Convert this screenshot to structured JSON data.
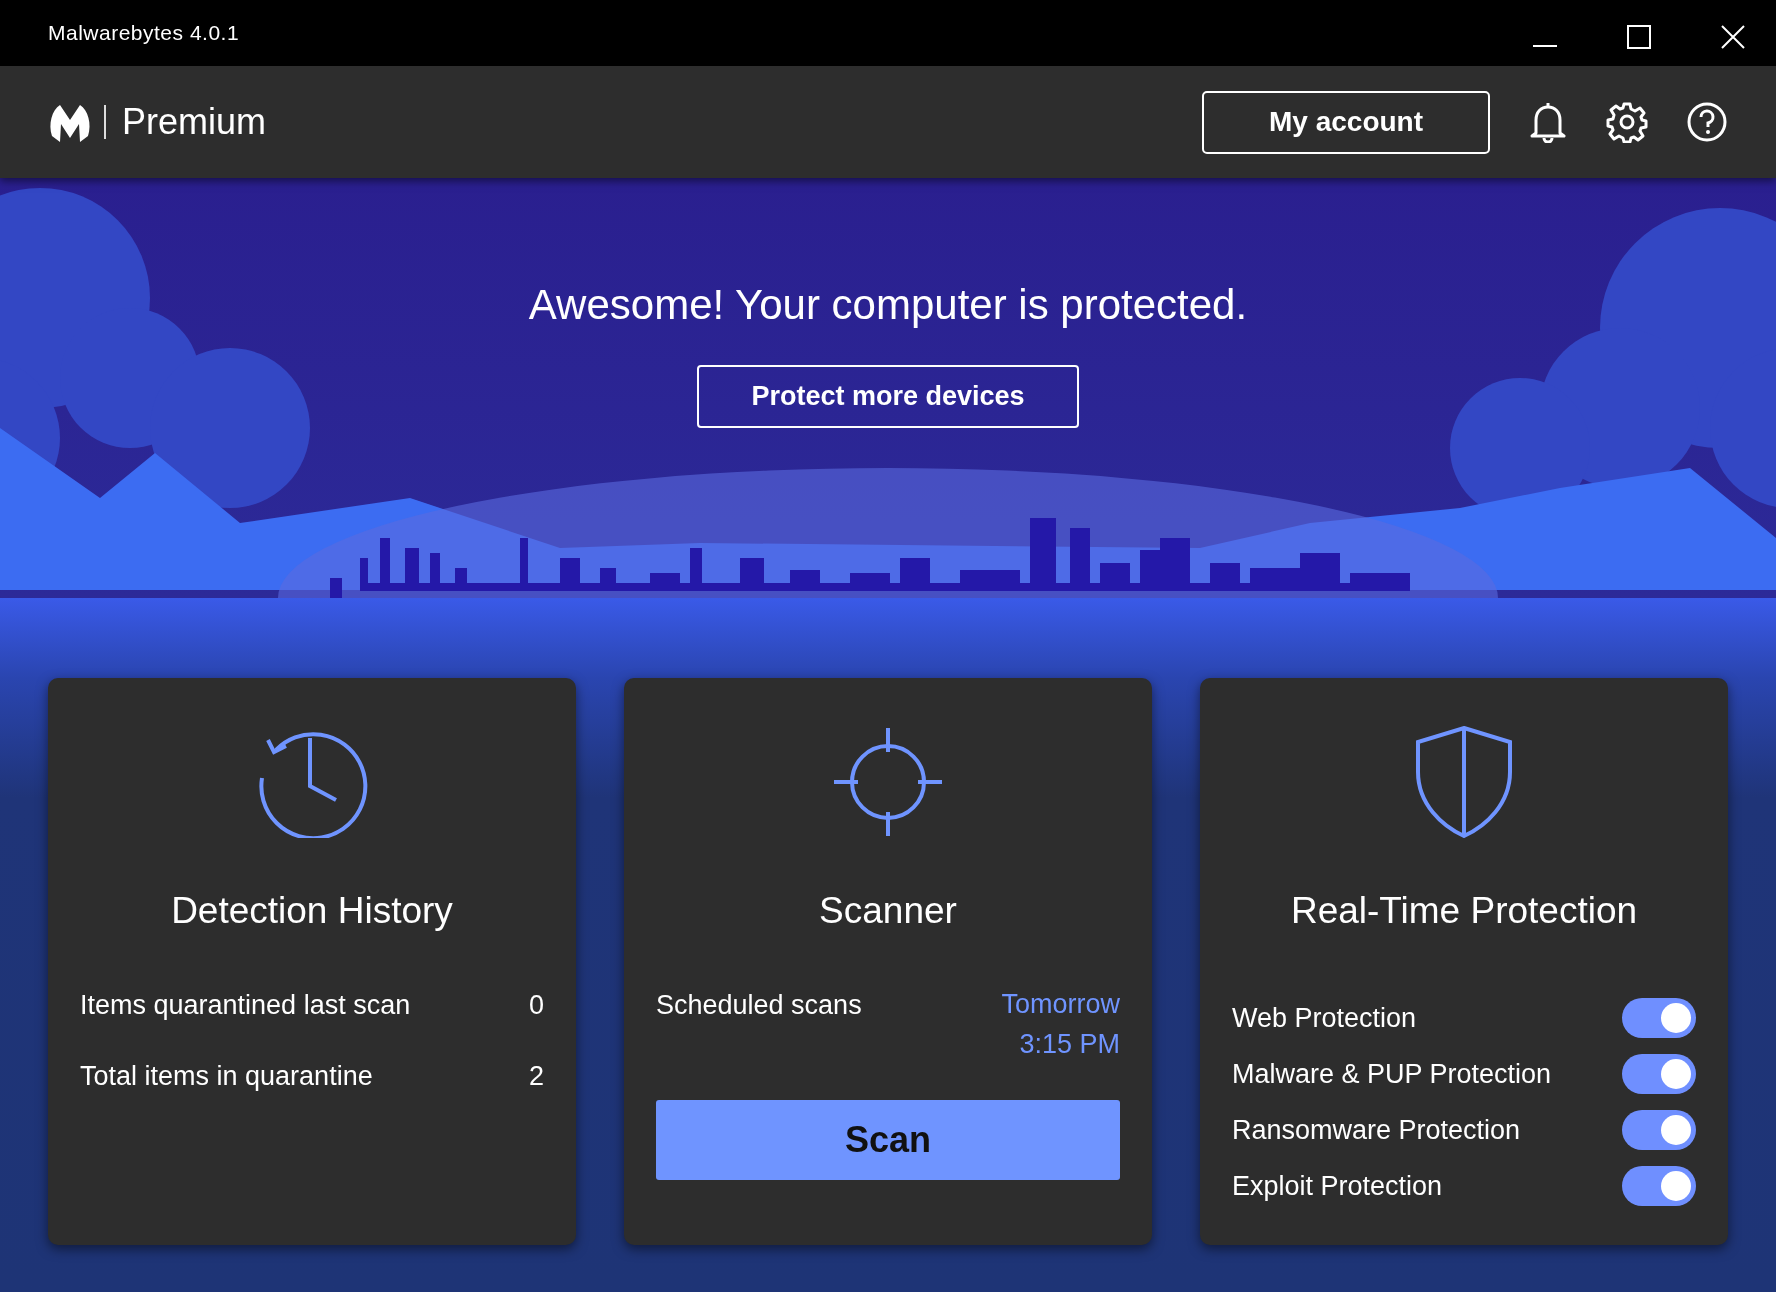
{
  "window": {
    "title": "Malwarebytes 4.0.1"
  },
  "header": {
    "edition": "Premium",
    "account_button": "My account"
  },
  "hero": {
    "message": "Awesome! Your computer is protected.",
    "button": "Protect more devices"
  },
  "cards": [
    {
      "kind": "history",
      "title": "Detection History",
      "stats": [
        {
          "label": "Items quarantined last scan",
          "value": "0"
        },
        {
          "label": "Total items in quarantine",
          "value": "2"
        }
      ]
    },
    {
      "kind": "scanner",
      "title": "Scanner",
      "schedule_label": "Scheduled scans",
      "schedule_value": "Tomorrow 3:15 PM",
      "button": "Scan"
    },
    {
      "kind": "protection",
      "title": "Real-Time Protection",
      "toggles": [
        {
          "label": "Web Protection",
          "on": true
        },
        {
          "label": "Malware & PUP Protection",
          "on": true
        },
        {
          "label": "Ransomware Protection",
          "on": true
        },
        {
          "label": "Exploit Protection",
          "on": true
        }
      ]
    }
  ]
}
